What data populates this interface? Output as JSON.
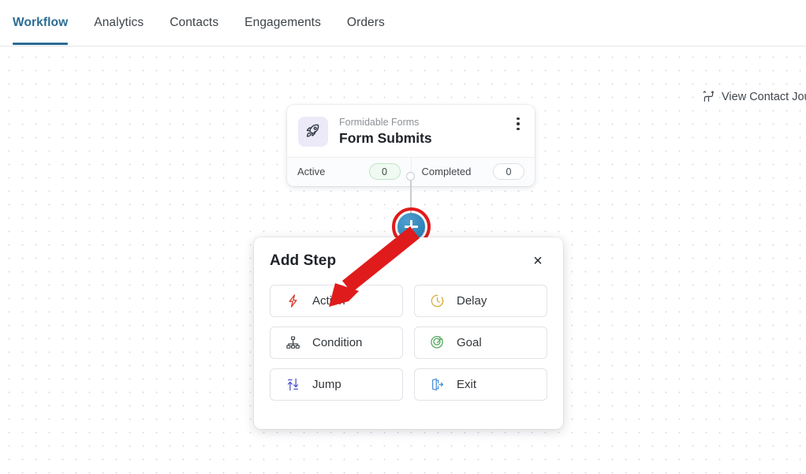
{
  "tabs": [
    {
      "label": "Workflow",
      "active": true
    },
    {
      "label": "Analytics",
      "active": false
    },
    {
      "label": "Contacts",
      "active": false
    },
    {
      "label": "Engagements",
      "active": false
    },
    {
      "label": "Orders",
      "active": false
    }
  ],
  "canvas": {
    "journey_link": {
      "label": "View Contact Jou",
      "icon": "journey-branch-icon"
    },
    "node": {
      "icon": "rocket-icon",
      "app_name": "Formidable Forms",
      "title": "Form Submits",
      "menu_icon": "kebab-menu-icon",
      "stats": [
        {
          "label": "Active",
          "value": "0",
          "style": "green"
        },
        {
          "label": "Completed",
          "value": "0",
          "style": "plain"
        }
      ]
    },
    "add_button": {
      "icon": "plus-icon",
      "highlighted": true
    }
  },
  "modal": {
    "title": "Add Step",
    "close_label": "×",
    "options": [
      {
        "label": "Action",
        "icon": "lightning-bolt-icon",
        "color": "#d8342a"
      },
      {
        "label": "Delay",
        "icon": "clock-icon",
        "color": "#d9ab3c"
      },
      {
        "label": "Condition",
        "icon": "sitemap-icon",
        "color": "#3d4349"
      },
      {
        "label": "Goal",
        "icon": "target-goal-icon",
        "color": "#52a85c"
      },
      {
        "label": "Jump",
        "icon": "jump-arrows-icon",
        "color": "#4a55c8"
      },
      {
        "label": "Exit",
        "icon": "exit-door-icon",
        "color": "#4d8fd6"
      }
    ]
  },
  "annotation": {
    "arrow_color": "#e01b1b",
    "ring_color": "#e01b1b"
  },
  "colors": {
    "accent": "#2b6c94",
    "plus_button": "#2f82b5",
    "annotation_red": "#e01b1b",
    "node_icon_bg": "#eceaf8",
    "active_pill_bg": "#f0faf2"
  }
}
